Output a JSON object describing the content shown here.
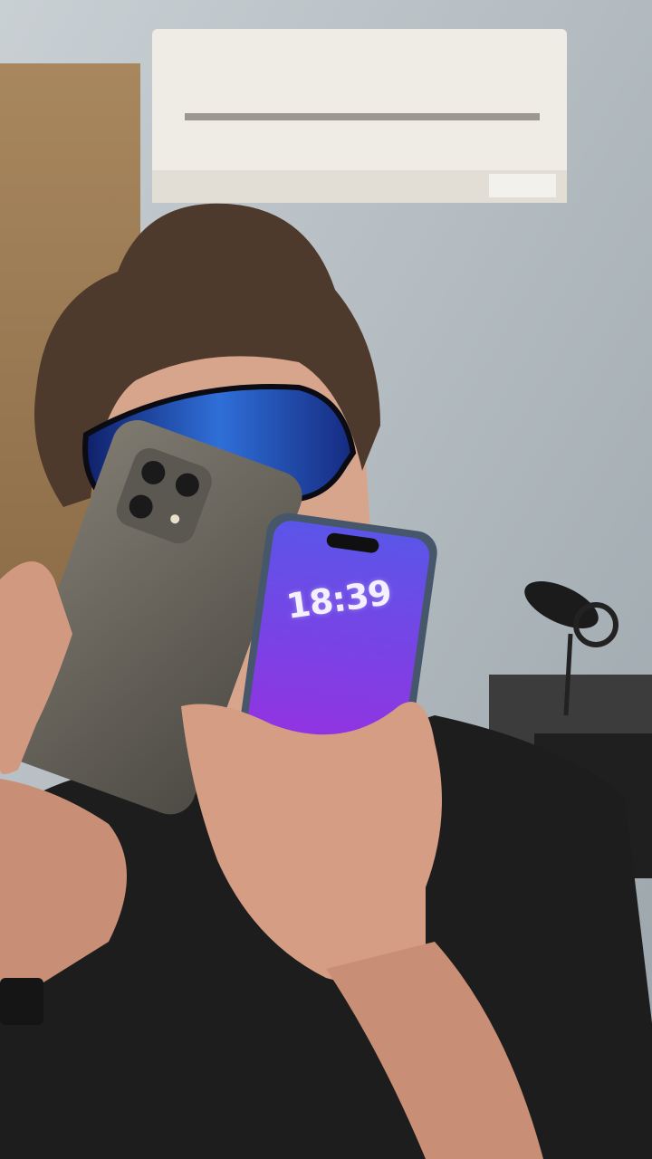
{
  "scene": {
    "description_kind": "photo",
    "lockscreen_time": "18:39"
  },
  "colors": {
    "wall": "#b9c3c9",
    "shirt": "#1d1d1d",
    "phone_screen": "#7b43e0",
    "goggles": "#1f3fa8"
  }
}
